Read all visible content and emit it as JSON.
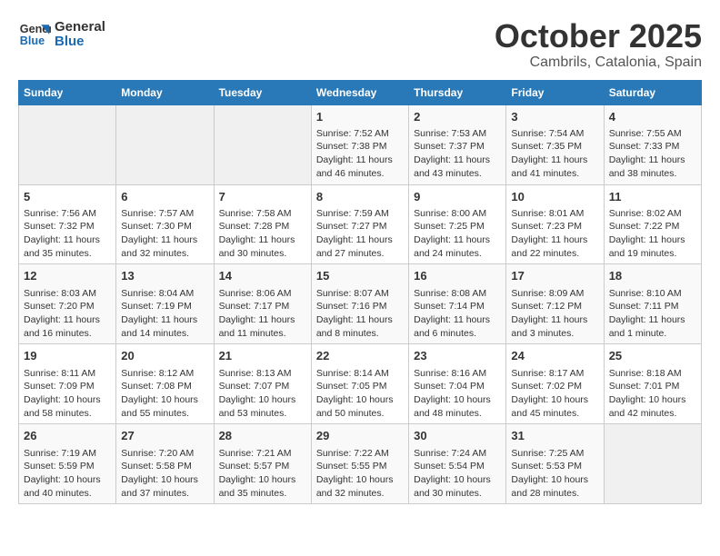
{
  "header": {
    "logo_line1": "General",
    "logo_line2": "Blue",
    "month_title": "October 2025",
    "location": "Cambrils, Catalonia, Spain"
  },
  "days_of_week": [
    "Sunday",
    "Monday",
    "Tuesday",
    "Wednesday",
    "Thursday",
    "Friday",
    "Saturday"
  ],
  "weeks": [
    [
      {
        "day": "",
        "content": ""
      },
      {
        "day": "",
        "content": ""
      },
      {
        "day": "",
        "content": ""
      },
      {
        "day": "1",
        "content": "Sunrise: 7:52 AM\nSunset: 7:38 PM\nDaylight: 11 hours and 46 minutes."
      },
      {
        "day": "2",
        "content": "Sunrise: 7:53 AM\nSunset: 7:37 PM\nDaylight: 11 hours and 43 minutes."
      },
      {
        "day": "3",
        "content": "Sunrise: 7:54 AM\nSunset: 7:35 PM\nDaylight: 11 hours and 41 minutes."
      },
      {
        "day": "4",
        "content": "Sunrise: 7:55 AM\nSunset: 7:33 PM\nDaylight: 11 hours and 38 minutes."
      }
    ],
    [
      {
        "day": "5",
        "content": "Sunrise: 7:56 AM\nSunset: 7:32 PM\nDaylight: 11 hours and 35 minutes."
      },
      {
        "day": "6",
        "content": "Sunrise: 7:57 AM\nSunset: 7:30 PM\nDaylight: 11 hours and 32 minutes."
      },
      {
        "day": "7",
        "content": "Sunrise: 7:58 AM\nSunset: 7:28 PM\nDaylight: 11 hours and 30 minutes."
      },
      {
        "day": "8",
        "content": "Sunrise: 7:59 AM\nSunset: 7:27 PM\nDaylight: 11 hours and 27 minutes."
      },
      {
        "day": "9",
        "content": "Sunrise: 8:00 AM\nSunset: 7:25 PM\nDaylight: 11 hours and 24 minutes."
      },
      {
        "day": "10",
        "content": "Sunrise: 8:01 AM\nSunset: 7:23 PM\nDaylight: 11 hours and 22 minutes."
      },
      {
        "day": "11",
        "content": "Sunrise: 8:02 AM\nSunset: 7:22 PM\nDaylight: 11 hours and 19 minutes."
      }
    ],
    [
      {
        "day": "12",
        "content": "Sunrise: 8:03 AM\nSunset: 7:20 PM\nDaylight: 11 hours and 16 minutes."
      },
      {
        "day": "13",
        "content": "Sunrise: 8:04 AM\nSunset: 7:19 PM\nDaylight: 11 hours and 14 minutes."
      },
      {
        "day": "14",
        "content": "Sunrise: 8:06 AM\nSunset: 7:17 PM\nDaylight: 11 hours and 11 minutes."
      },
      {
        "day": "15",
        "content": "Sunrise: 8:07 AM\nSunset: 7:16 PM\nDaylight: 11 hours and 8 minutes."
      },
      {
        "day": "16",
        "content": "Sunrise: 8:08 AM\nSunset: 7:14 PM\nDaylight: 11 hours and 6 minutes."
      },
      {
        "day": "17",
        "content": "Sunrise: 8:09 AM\nSunset: 7:12 PM\nDaylight: 11 hours and 3 minutes."
      },
      {
        "day": "18",
        "content": "Sunrise: 8:10 AM\nSunset: 7:11 PM\nDaylight: 11 hours and 1 minute."
      }
    ],
    [
      {
        "day": "19",
        "content": "Sunrise: 8:11 AM\nSunset: 7:09 PM\nDaylight: 10 hours and 58 minutes."
      },
      {
        "day": "20",
        "content": "Sunrise: 8:12 AM\nSunset: 7:08 PM\nDaylight: 10 hours and 55 minutes."
      },
      {
        "day": "21",
        "content": "Sunrise: 8:13 AM\nSunset: 7:07 PM\nDaylight: 10 hours and 53 minutes."
      },
      {
        "day": "22",
        "content": "Sunrise: 8:14 AM\nSunset: 7:05 PM\nDaylight: 10 hours and 50 minutes."
      },
      {
        "day": "23",
        "content": "Sunrise: 8:16 AM\nSunset: 7:04 PM\nDaylight: 10 hours and 48 minutes."
      },
      {
        "day": "24",
        "content": "Sunrise: 8:17 AM\nSunset: 7:02 PM\nDaylight: 10 hours and 45 minutes."
      },
      {
        "day": "25",
        "content": "Sunrise: 8:18 AM\nSunset: 7:01 PM\nDaylight: 10 hours and 42 minutes."
      }
    ],
    [
      {
        "day": "26",
        "content": "Sunrise: 7:19 AM\nSunset: 5:59 PM\nDaylight: 10 hours and 40 minutes."
      },
      {
        "day": "27",
        "content": "Sunrise: 7:20 AM\nSunset: 5:58 PM\nDaylight: 10 hours and 37 minutes."
      },
      {
        "day": "28",
        "content": "Sunrise: 7:21 AM\nSunset: 5:57 PM\nDaylight: 10 hours and 35 minutes."
      },
      {
        "day": "29",
        "content": "Sunrise: 7:22 AM\nSunset: 5:55 PM\nDaylight: 10 hours and 32 minutes."
      },
      {
        "day": "30",
        "content": "Sunrise: 7:24 AM\nSunset: 5:54 PM\nDaylight: 10 hours and 30 minutes."
      },
      {
        "day": "31",
        "content": "Sunrise: 7:25 AM\nSunset: 5:53 PM\nDaylight: 10 hours and 28 minutes."
      },
      {
        "day": "",
        "content": ""
      }
    ]
  ]
}
